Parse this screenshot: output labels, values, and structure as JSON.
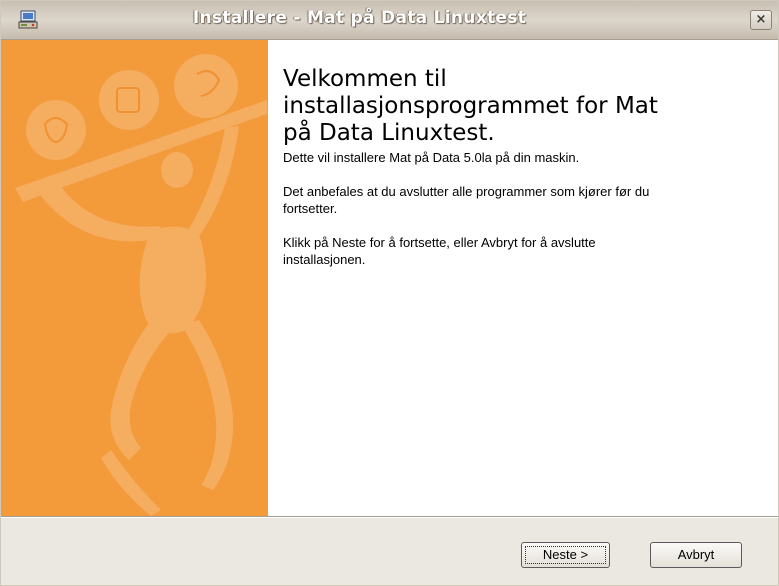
{
  "window": {
    "title": "Installere - Mat på Data Linuxtest",
    "close_symbol": "×"
  },
  "icons": {
    "app": "installer-computer-icon",
    "close": "close-icon",
    "side_illustration": "juggling-figure-illustration"
  },
  "colors": {
    "side_panel": "#f39a3b",
    "side_panel_shapes": "#f5ad60"
  },
  "welcome": {
    "heading_line1": "Velkommen til",
    "heading_line2": "installasjonsprogrammet for Mat",
    "heading_line3": "på Data Linuxtest.",
    "paragraph1": "Dette vil installere Mat på Data 5.0la på din maskin.",
    "paragraph2_line1": "Det anbefales at du avslutter alle programmer som kjører før du",
    "paragraph2_line2": "fortsetter.",
    "paragraph3_line1": "Klikk på Neste for å fortsette, eller Avbryt for å avslutte",
    "paragraph3_line2": "installasjonen."
  },
  "buttons": {
    "next_label": "Neste >",
    "cancel_label": "Avbryt"
  }
}
